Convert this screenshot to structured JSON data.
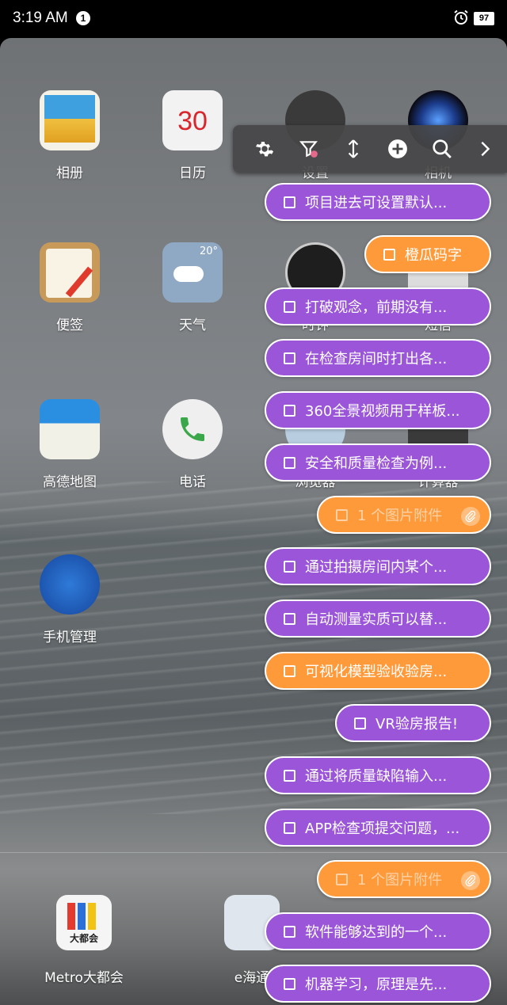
{
  "status_bar": {
    "time": "3:19 AM",
    "notification_count": "1",
    "battery": "97"
  },
  "home": {
    "apps": [
      {
        "label": "相册"
      },
      {
        "label": "日历",
        "day": "30"
      },
      {
        "label": "设置"
      },
      {
        "label": "相机"
      },
      {
        "label": "便签"
      },
      {
        "label": "天气",
        "temp": "20°"
      },
      {
        "label": "时钟"
      },
      {
        "label": "短信"
      },
      {
        "label": "高德地图"
      },
      {
        "label": "电话"
      },
      {
        "label": "浏览器"
      },
      {
        "label": "计算器"
      },
      {
        "label": "手机管理"
      }
    ],
    "dock": [
      {
        "label": "Metro大都会",
        "icon_text": "大都会"
      },
      {
        "label": "e海通"
      }
    ]
  },
  "toolbar": {
    "buttons": [
      {
        "icon": "gear-icon"
      },
      {
        "icon": "filter-icon"
      },
      {
        "icon": "sort-icon"
      },
      {
        "icon": "add-icon"
      },
      {
        "icon": "search-icon"
      },
      {
        "icon": "chevron-right-icon"
      }
    ]
  },
  "notes": [
    {
      "text": "项目进去可设置默认...",
      "color": "purple"
    },
    {
      "text": "橙瓜码字",
      "color": "orange"
    },
    {
      "text": "打破观念，前期没有...",
      "color": "purple"
    },
    {
      "text": "在检查房间时打出各...",
      "color": "purple"
    },
    {
      "text": "360全景视频用于样板...",
      "color": "purple"
    },
    {
      "text": "安全和质量检查为例...",
      "color": "purple"
    },
    {
      "text": "1 个图片附件",
      "color": "orange",
      "attachment": true
    },
    {
      "text": "通过拍摄房间内某个...",
      "color": "purple"
    },
    {
      "text": "自动测量实质可以替...",
      "color": "purple"
    },
    {
      "text": "可视化模型验收验房...",
      "color": "orange"
    },
    {
      "text": "VR验房报告!",
      "color": "purple"
    },
    {
      "text": "通过将质量缺陷输入...",
      "color": "purple"
    },
    {
      "text": "APP检查项提交问题，...",
      "color": "purple"
    },
    {
      "text": "1 个图片附件",
      "color": "orange",
      "attachment": true
    },
    {
      "text": "软件能够达到的一个...",
      "color": "purple"
    },
    {
      "text": "机器学习，原理是先...",
      "color": "purple"
    }
  ],
  "colors": {
    "purple": "#9b55d8",
    "orange": "#ff9a3a"
  }
}
